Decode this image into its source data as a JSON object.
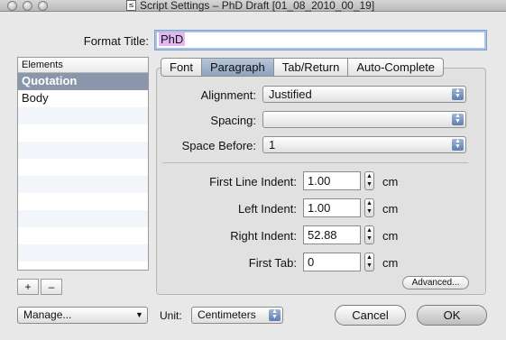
{
  "window": {
    "title": "Script Settings – PhD Draft [01_08_2010_00_19]",
    "doc_icon_glyph": "≤"
  },
  "format_title": {
    "label": "Format Title:",
    "value": "PhD"
  },
  "elements": {
    "header": "Elements",
    "items": [
      "Quotation",
      "Body",
      "",
      "",
      "",
      "",
      "",
      "",
      "",
      "",
      "",
      ""
    ],
    "selected_index": 0,
    "add_label": "+",
    "remove_label": "–"
  },
  "tabs": [
    {
      "label": "Font",
      "active": false
    },
    {
      "label": "Paragraph",
      "active": true
    },
    {
      "label": "Tab/Return",
      "active": false
    },
    {
      "label": "Auto-Complete",
      "active": false
    }
  ],
  "paragraph": {
    "alignment_label": "Alignment:",
    "alignment_value": "Justified",
    "spacing_label": "Spacing:",
    "spacing_value": "",
    "space_before_label": "Space Before:",
    "space_before_value": "1",
    "first_line_indent_label": "First Line Indent:",
    "first_line_indent_value": "1.00",
    "left_indent_label": "Left Indent:",
    "left_indent_value": "1.00",
    "right_indent_label": "Right Indent:",
    "right_indent_value": "52.88",
    "first_tab_label": "First Tab:",
    "first_tab_value": "0",
    "unit": "cm",
    "advanced_label": "Advanced..."
  },
  "bottom": {
    "manage_label": "Manage...",
    "unit_label": "Unit:",
    "unit_value": "Centimeters",
    "cancel_label": "Cancel",
    "ok_label": "OK"
  },
  "colors": {
    "selection_bg": "#8a96ab",
    "tab_active": "#9fb2cb",
    "title_highlight": "#e3b8f0"
  }
}
